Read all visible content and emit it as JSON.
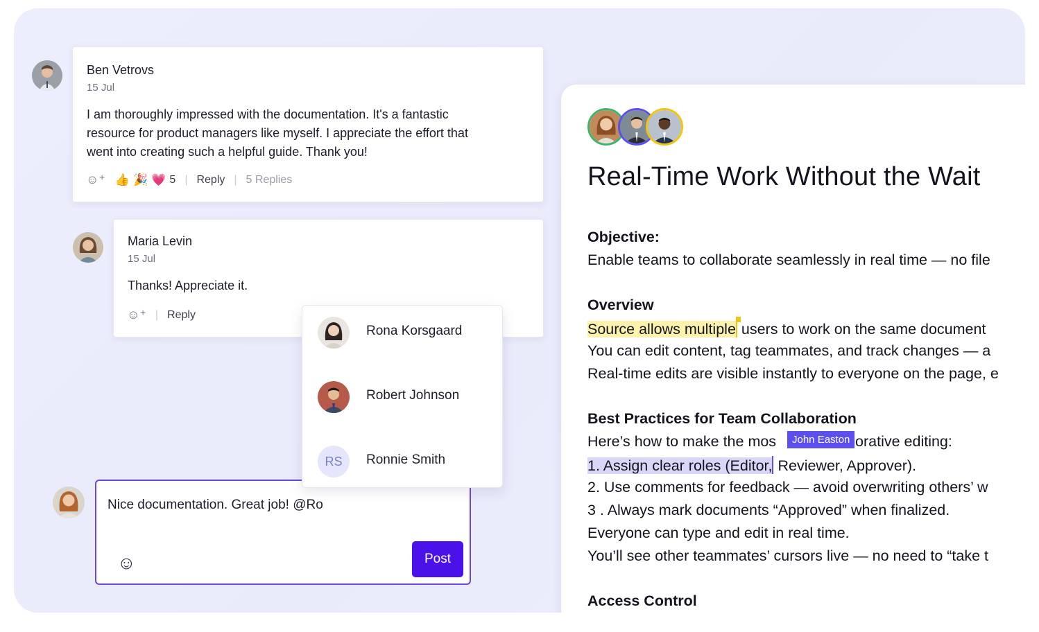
{
  "comments": [
    {
      "author": "Ben Vetrovs",
      "date": "15 Jul",
      "body_lines": [
        "I am thoroughly impressed with the documentation. It's a fantastic",
        "resource for product managers like myself. I appreciate the effort that",
        "went into creating such a helpful guide. Thank you!"
      ],
      "reactions": [
        "👍",
        "🎉",
        "💗"
      ],
      "reaction_count": "5",
      "reply_label": "Reply",
      "replies_label": "5 Replies"
    },
    {
      "author": "Maria Levin",
      "date": "15 Jul",
      "body_lines": [
        "Thanks! Appreciate it."
      ],
      "reply_label": "Reply"
    }
  ],
  "mention_list": [
    {
      "name": "Rona Korsgaard",
      "initials": ""
    },
    {
      "name": "Robert Johnson",
      "initials": ""
    },
    {
      "name": "Ronnie Smith",
      "initials": "RS"
    }
  ],
  "composer": {
    "text": "Nice documentation. Great job! @Ro",
    "post_label": "Post"
  },
  "document": {
    "title": "Real-Time Work Without the Wait",
    "objective_heading": "Objective:",
    "objective_text": "Enable teams to collaborate seamlessly in real time — no file",
    "overview_heading": "Overview",
    "overview_highlight": "Source allows multiple",
    "overview_line1_rest": "users to work on the same document",
    "overview_line2": " You can edit content, tag teammates, and track changes — a",
    "overview_line3": "Real-time edits are visible instantly to everyone on the page, e",
    "practices_heading": "Best Practices for Team Collaboration",
    "practices_intro_a": "Here’s how to make the mos",
    "practices_intro_b": "borative editing:",
    "cursor_user": "John Easton",
    "item1_highlight": "1.  Assign clear roles (Editor,",
    "item1_rest": " Reviewer, Approver).",
    "item2": "2.  Use comments for feedback — avoid overwriting others’ w",
    "item3": "3 .  Always mark documents “Approved” when finalized.",
    "line_everyone": "Everyone can type and edit in real time.",
    "line_cursors": " You’ll see other teammates’ cursors live — no need to “take t",
    "access_heading": "Access Control"
  },
  "colors": {
    "accent": "#4a12e8",
    "composer_border": "#6b45e6",
    "cursor_purple": "#5b4ff0",
    "highlight_yellow": "#fcf2ac",
    "highlight_purple": "#d9d6f7",
    "collab_ring_1": "#3fb36b",
    "collab_ring_2": "#5b4ff0",
    "collab_ring_3": "#f1c40f"
  }
}
